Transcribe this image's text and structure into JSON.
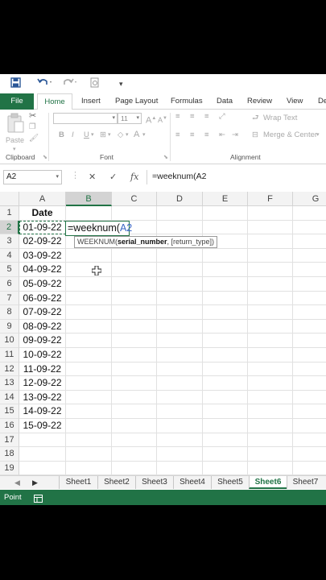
{
  "qat": {
    "save": "save-icon",
    "undo": "undo-icon",
    "redo": "redo-icon",
    "preview": "print-preview-icon",
    "customize": "customize-qat-icon"
  },
  "ribbon_tabs": [
    "File",
    "Home",
    "Insert",
    "Page Layout",
    "Formulas",
    "Data",
    "Review",
    "View",
    "De"
  ],
  "active_tab": "Home",
  "ribbon": {
    "clipboard": {
      "paste": "Paste",
      "label": "Clipboard"
    },
    "font": {
      "label": "Font",
      "size": "11",
      "bold": "B",
      "italic": "I",
      "underline": "U",
      "font_color": "A"
    },
    "alignment": {
      "wrap": "Wrap Text",
      "merge": "Merge & Center",
      "label": "Alignment"
    }
  },
  "formula_bar": {
    "name_box": "A2",
    "cancel": "✕",
    "enter": "✓",
    "fx": "fx",
    "content": "=weeknum(A2"
  },
  "columns": [
    "A",
    "B",
    "C",
    "D",
    "E",
    "F",
    "G"
  ],
  "selected_column": "B",
  "rows": [
    "1",
    "2",
    "3",
    "4",
    "5",
    "6",
    "7",
    "8",
    "9",
    "10",
    "11",
    "12",
    "13",
    "14",
    "15",
    "16",
    "17",
    "18",
    "19"
  ],
  "selected_row": "2",
  "column_a": [
    "Date",
    "01-09-22",
    "02-09-22",
    "03-09-22",
    "04-09-22",
    "05-09-22",
    "06-09-22",
    "07-09-22",
    "08-09-22",
    "09-09-22",
    "10-09-22",
    "11-09-22",
    "12-09-22",
    "13-09-22",
    "14-09-22",
    "15-09-22"
  ],
  "edit_cell": {
    "prefix": "=weeknum(",
    "ref": "A2"
  },
  "tooltip": {
    "func": "WEEKNUM(",
    "arg1": "serial_number",
    "rest": ", [return_type])"
  },
  "sheets": [
    "Sheet1",
    "Sheet2",
    "Sheet3",
    "Sheet4",
    "Sheet5",
    "Sheet6",
    "Sheet7"
  ],
  "active_sheet": "Sheet6",
  "status": {
    "mode": "Point"
  },
  "colors": {
    "accent": "#217346",
    "ref": "#3a66c4"
  }
}
